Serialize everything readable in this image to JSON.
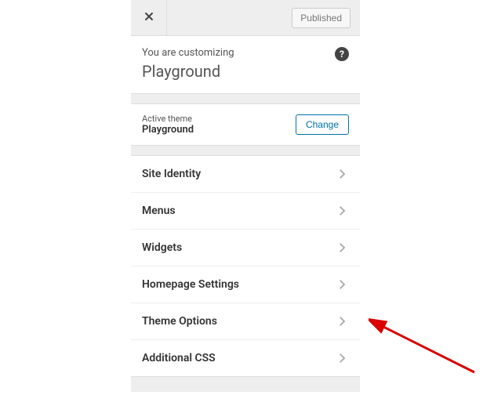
{
  "topbar": {
    "published_label": "Published"
  },
  "intro": {
    "customizing_label": "You are customizing",
    "site_title": "Playground"
  },
  "theme": {
    "label": "Active theme",
    "name": "Playground",
    "change_label": "Change"
  },
  "menu": {
    "items": [
      {
        "label": "Site Identity"
      },
      {
        "label": "Menus"
      },
      {
        "label": "Widgets"
      },
      {
        "label": "Homepage Settings"
      },
      {
        "label": "Theme Options"
      },
      {
        "label": "Additional CSS"
      }
    ]
  }
}
